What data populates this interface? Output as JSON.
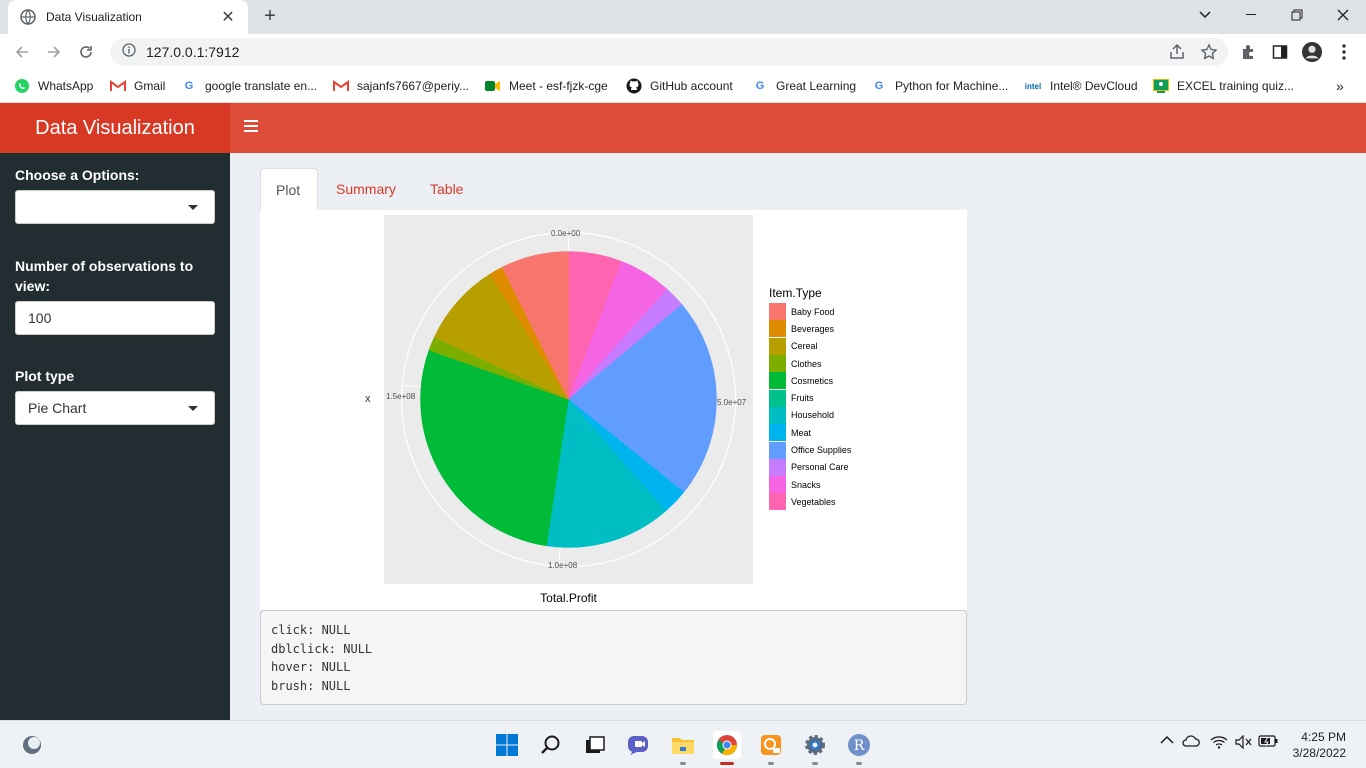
{
  "browser": {
    "tab_title": "Data Visualization",
    "url": "127.0.0.1:7912",
    "bookmarks": [
      {
        "label": "WhatsApp",
        "icon": "whatsapp-icon"
      },
      {
        "label": "Gmail",
        "icon": "gmail-icon"
      },
      {
        "label": "google translate en...",
        "icon": "google-icon"
      },
      {
        "label": "sajanfs7667@periy...",
        "icon": "gmail-icon"
      },
      {
        "label": "Meet - esf-fjzk-cge",
        "icon": "meet-icon"
      },
      {
        "label": "GitHub account",
        "icon": "github-icon"
      },
      {
        "label": "Great Learning",
        "icon": "google-icon"
      },
      {
        "label": "Python for Machine...",
        "icon": "google-icon"
      },
      {
        "label": "Intel® DevCloud",
        "icon": "intel-icon"
      },
      {
        "label": "EXCEL training quiz...",
        "icon": "classroom-icon"
      }
    ],
    "intel_logo_text": "intel"
  },
  "app": {
    "title": "Data Visualization",
    "sidebar": {
      "option_label": "Choose a Options:",
      "option_value": "",
      "obs_label": "Number of observations to view:",
      "obs_value": "100",
      "plot_type_label": "Plot type",
      "plot_type_value": "Pie Chart"
    },
    "tabs": [
      "Plot",
      "Summary",
      "Table"
    ],
    "active_tab": "Plot",
    "verbatim": [
      "click: NULL",
      "dblclick: NULL",
      "hover: NULL",
      "brush: NULL"
    ]
  },
  "chart_data": {
    "type": "pie",
    "xlabel": "Total.Profit",
    "ylabel": "x",
    "ticks": [
      "0.0e+00",
      "5.0e+07",
      "1.0e+08",
      "1.5e+08"
    ],
    "tick_values": [
      0,
      50000000,
      100000000,
      150000000
    ],
    "total": 196500000,
    "legend_title": "Item.Type",
    "categories": [
      "Baby Food",
      "Beverages",
      "Cereal",
      "Clothes",
      "Cosmetics",
      "Fruits",
      "Household",
      "Meat",
      "Office Supplies",
      "Personal Care",
      "Snacks",
      "Vegetables"
    ],
    "colors": [
      "#F8766D",
      "#DE8C00",
      "#B79F00",
      "#7CAE00",
      "#00BA38",
      "#00C08B",
      "#00BFC4",
      "#00B4F0",
      "#619CFF",
      "#C77CFF",
      "#F564E3",
      "#FF64B0"
    ],
    "values": [
      14500000,
      3000000,
      18000000,
      3000000,
      55000000,
      200000,
      27000000,
      5500000,
      43000000,
      4500000,
      11300000,
      11500000
    ],
    "start_category_order": "from 12 o'clock clockwise: Vegetables, Snacks, Personal Care, Office Supplies, Meat, Household, Fruits, Cosmetics, Clothes, Cereal, Beverages, Baby Food"
  },
  "taskbar": {
    "time": "4:25 PM",
    "date": "3/28/2022",
    "r_label": "R"
  }
}
